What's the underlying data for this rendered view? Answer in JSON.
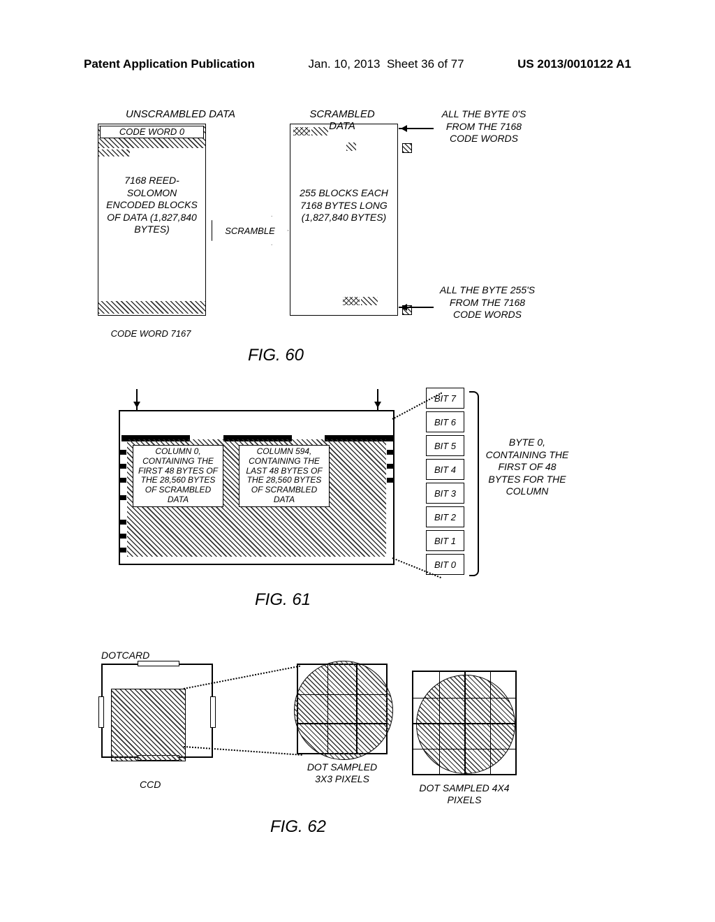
{
  "header": {
    "left": "Patent Application Publication",
    "date": "Jan. 10, 2013",
    "sheet": "Sheet 36 of 77",
    "pubno": "US 2013/0010122 A1"
  },
  "fig60": {
    "caption": "FIG. 60",
    "unscrambled_label": "UNSCRAMBLED DATA",
    "scrambled_label": "SCRAMBLED DATA",
    "code_word_top": "CODE WORD 0",
    "code_word_bottom": "CODE WORD 7167",
    "left_text": "7168 REED-SOLOMON ENCODED BLOCKS OF DATA (1,827,840 BYTES)",
    "right_text": "255 BLOCKS EACH 7168 BYTES LONG (1,827,840 BYTES)",
    "scramble": "SCRAMBLE",
    "note_top": "ALL THE BYTE 0'S FROM THE 7168 CODE WORDS",
    "note_bottom": "ALL THE BYTE 255'S FROM THE 7168 CODE WORDS"
  },
  "fig61": {
    "caption": "FIG. 61",
    "col0": "COLUMN 0, CONTAINING THE FIRST 48 BYTES OF THE 28,560 BYTES OF SCRAMBLED DATA",
    "col594": "COLUMN 594, CONTAINING THE LAST 48 BYTES OF THE 28,560 BYTES OF SCRAMBLED DATA",
    "bits": [
      "BIT 7",
      "BIT 6",
      "BIT 5",
      "BIT 4",
      "BIT 3",
      "BIT 2",
      "BIT 1",
      "BIT 0"
    ],
    "byte_text": "BYTE 0, CONTAINING THE FIRST OF 48 BYTES FOR THE COLUMN"
  },
  "fig62": {
    "caption": "FIG. 62",
    "dotcard": "DOTCARD",
    "ccd": "CCD",
    "dot3": "DOT SAMPLED 3X3 PIXELS",
    "dot4": "DOT SAMPLED 4X4 PIXELS"
  }
}
